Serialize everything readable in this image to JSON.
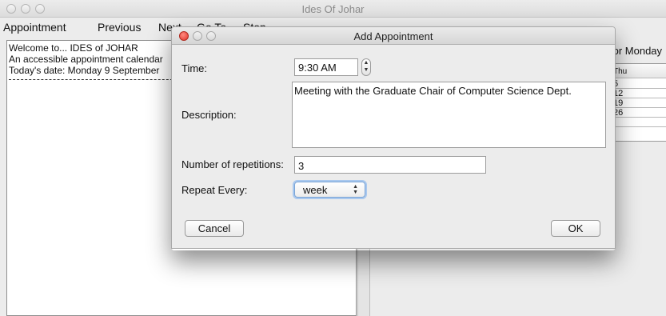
{
  "window": {
    "title": "Ides Of Johar"
  },
  "menu": [
    "Appointment",
    "Previous",
    "Next",
    "Go To",
    "Stop"
  ],
  "welcome": {
    "lines": [
      "Welcome to... IDES of JOHAR",
      "An accessible appointment calendar",
      "Today's date:  Monday 9 September"
    ]
  },
  "calendar": {
    "header": "for Monday",
    "column": "Thu",
    "rows": [
      "5",
      "12",
      "19",
      "26",
      ""
    ]
  },
  "dialog": {
    "title": "Add Appointment",
    "time_label": "Time:",
    "time_value": "9:30 AM",
    "description_label": "Description:",
    "description_value": "Meeting with the Graduate Chair of Computer Science Dept.",
    "repetitions_label": "Number of repetitions:",
    "repetitions_value": "3",
    "repeat_label": "Repeat Every:",
    "repeat_value": "week",
    "cancel_label": "Cancel",
    "ok_label": "OK"
  },
  "colors": {
    "close_button": "#e0342b",
    "focus_ring": "#a9c8ee"
  }
}
